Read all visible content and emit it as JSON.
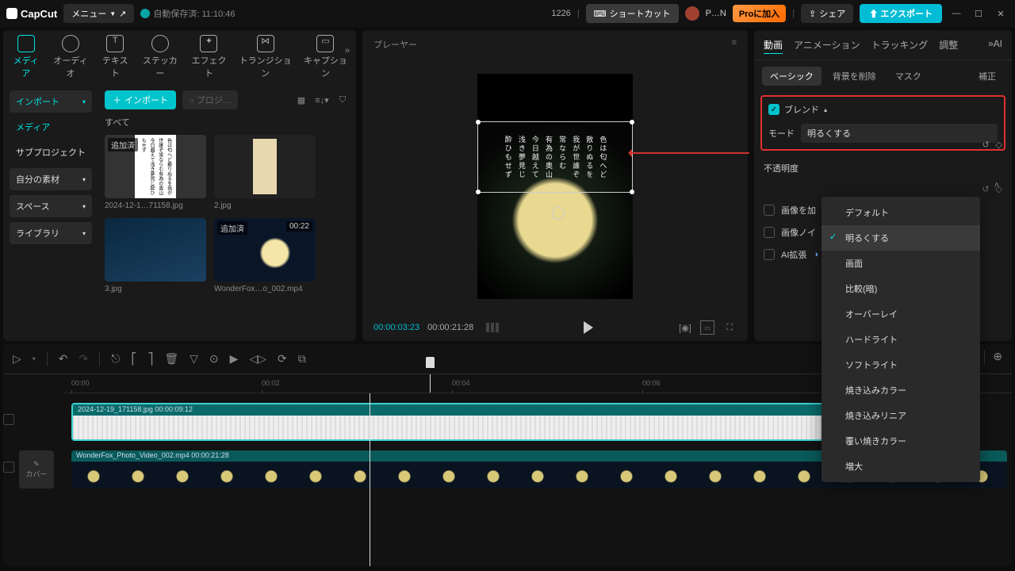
{
  "top": {
    "logo": "CapCut",
    "menu": "メニュー",
    "autosave": "自動保存済: 11:10:46",
    "upgrade": "1226",
    "shortcut": "ショートカット",
    "user": "P…N",
    "pro": "Proに加入",
    "share": "シェア",
    "export": "エクスポート"
  },
  "tools": {
    "media": "メディア",
    "audio": "オーディオ",
    "text": "テキスト",
    "sticker": "ステッカー",
    "effect": "エフェクト",
    "transition": "トランジション",
    "caption": "キャプション"
  },
  "leftSidebar": {
    "import": "インポート",
    "media": "メディア",
    "subproject": "サブプロジェクト",
    "myassets": "自分の素材",
    "space": "スペース",
    "library": "ライブラリ"
  },
  "mediaHeader": {
    "import": "インポート",
    "searchPlaceholder": "プロジ…",
    "all": "すべて"
  },
  "mediaItems": [
    {
      "badge": "追加済",
      "label": "2024-12-1…71158.jpg"
    },
    {
      "badge": "",
      "label": "2.jpg"
    },
    {
      "badge": "",
      "label": "3.jpg"
    },
    {
      "badge": "追加済",
      "dur": "00:22",
      "label": "WonderFox…o_002.mp4"
    }
  ],
  "player": {
    "title": "プレーヤー",
    "time1": "00:00:03:23",
    "time2": "00:00:21:28",
    "overlayText": "色は匂へど\n散りぬるを\n我が世誰ぞ\n常ならむ\n有為の奥山\n今日越えて\n浅き夢見じ\n酔ひもせず"
  },
  "right": {
    "tabs": {
      "video": "動画",
      "anim": "アニメーション",
      "track": "トラッキング",
      "adjust": "調整",
      "ai": "AI"
    },
    "subtabs": {
      "basic": "ベーシック",
      "bgremove": "背景を削除",
      "mask": "マスク",
      "correct": "補正"
    },
    "blend": {
      "title": "ブレンド",
      "mode": "モード",
      "value": "明るくする"
    },
    "opacity": "不透明度",
    "imageadd": "画像を加",
    "imagenoise": "画像ノイ",
    "aiexpand": "AI拡張",
    "resetAll": "↺",
    "dropdown": [
      "デフォルト",
      "明るくする",
      "画面",
      "比較(暗)",
      "オーバーレイ",
      "ハードライト",
      "ソフトライト",
      "焼き込みカラー",
      "焼き込みリニア",
      "覆い焼きカラー",
      "増大"
    ]
  },
  "timeline": {
    "ticks": [
      "00:00",
      "00:02",
      "00:04",
      "00:06"
    ],
    "clip1": "2024-12-19_171158.jpg   00:00:09:12",
    "clip2": "WonderFox_Photo_Video_002.mp4   00:00:21:28",
    "cover": "カバー"
  }
}
